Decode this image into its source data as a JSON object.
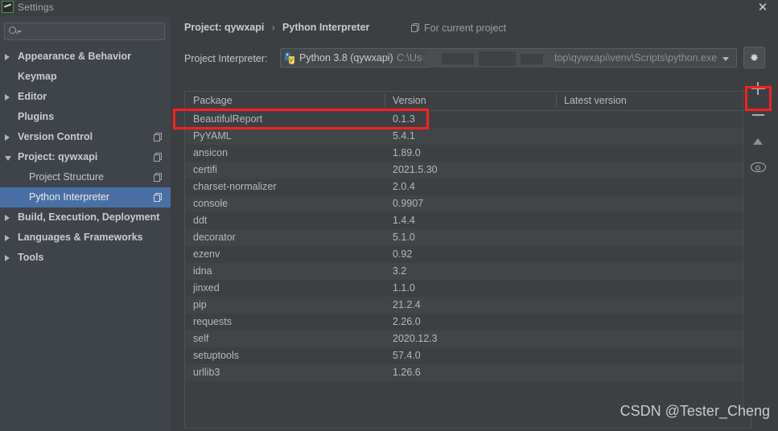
{
  "window": {
    "title": "Settings",
    "app_icon": "pycharm-icon",
    "close_label": "✕"
  },
  "sidebar": {
    "search": {
      "value": "",
      "placeholder": "",
      "icon": "search-icon"
    },
    "items": [
      {
        "label": "Appearance & Behavior",
        "indent": 22,
        "arrow": "closed",
        "bold": true,
        "copy": false,
        "selected": false
      },
      {
        "label": "Keymap",
        "indent": 22,
        "arrow": "none",
        "bold": true,
        "copy": false,
        "selected": false
      },
      {
        "label": "Editor",
        "indent": 22,
        "arrow": "closed",
        "bold": true,
        "copy": false,
        "selected": false
      },
      {
        "label": "Plugins",
        "indent": 22,
        "arrow": "none",
        "bold": true,
        "copy": false,
        "selected": false
      },
      {
        "label": "Version Control",
        "indent": 22,
        "arrow": "closed",
        "bold": true,
        "copy": true,
        "selected": false
      },
      {
        "label": "Project: qywxapi",
        "indent": 22,
        "arrow": "open",
        "bold": true,
        "copy": true,
        "selected": false
      },
      {
        "label": "Project Structure",
        "indent": 36,
        "arrow": "none",
        "bold": false,
        "copy": true,
        "selected": false
      },
      {
        "label": "Python Interpreter",
        "indent": 36,
        "arrow": "none",
        "bold": false,
        "copy": true,
        "selected": true
      },
      {
        "label": "Build, Execution, Deployment",
        "indent": 22,
        "arrow": "closed",
        "bold": true,
        "copy": false,
        "selected": false
      },
      {
        "label": "Languages & Frameworks",
        "indent": 22,
        "arrow": "closed",
        "bold": true,
        "copy": false,
        "selected": false
      },
      {
        "label": "Tools",
        "indent": 22,
        "arrow": "closed",
        "bold": true,
        "copy": false,
        "selected": false
      }
    ]
  },
  "header": {
    "breadcrumb": [
      "Project: qywxapi",
      "Python Interpreter"
    ],
    "breadcrumb_separator": "›",
    "for_current_project": "For current project",
    "for_current_project_icon": "copy-icon"
  },
  "interpreter": {
    "label": "Project Interpreter:",
    "icon": "python-venv-icon",
    "name": "Python 3.8 (qywxapi)",
    "path_prefix": "C:\\Use",
    "path_suffix": "top\\qywxapi\\venv\\Scripts\\python.exe",
    "redacted": true,
    "dropdown_icon": "chevron-down-icon",
    "settings_icon": "gear-icon"
  },
  "packages_table": {
    "columns": [
      "Package",
      "Version",
      "Latest version"
    ],
    "rows": [
      {
        "package": "BeautifulReport",
        "version": "0.1.3",
        "latest": ""
      },
      {
        "package": "PyYAML",
        "version": "5.4.1",
        "latest": ""
      },
      {
        "package": "ansicon",
        "version": "1.89.0",
        "latest": ""
      },
      {
        "package": "certifi",
        "version": "2021.5.30",
        "latest": ""
      },
      {
        "package": "charset-normalizer",
        "version": "2.0.4",
        "latest": ""
      },
      {
        "package": "console",
        "version": "0.9907",
        "latest": ""
      },
      {
        "package": "ddt",
        "version": "1.4.4",
        "latest": ""
      },
      {
        "package": "decorator",
        "version": "5.1.0",
        "latest": ""
      },
      {
        "package": "ezenv",
        "version": "0.92",
        "latest": ""
      },
      {
        "package": "idna",
        "version": "3.2",
        "latest": ""
      },
      {
        "package": "jinxed",
        "version": "1.1.0",
        "latest": ""
      },
      {
        "package": "pip",
        "version": "21.2.4",
        "latest": ""
      },
      {
        "package": "requests",
        "version": "2.26.0",
        "latest": ""
      },
      {
        "package": "self",
        "version": "2020.12.3",
        "latest": ""
      },
      {
        "package": "setuptools",
        "version": "57.4.0",
        "latest": ""
      },
      {
        "package": "urllib3",
        "version": "1.26.6",
        "latest": ""
      }
    ]
  },
  "toolbar": {
    "install_icon": "plus-icon",
    "uninstall_icon": "minus-icon",
    "upgrade_icon": "triangle-up-icon",
    "show_early_releases_icon": "eye-icon"
  },
  "annotations": {
    "accent_color": "#ff2020",
    "highlight_row": "BeautifulReport",
    "highlight_button": "install-package-button"
  },
  "watermark": {
    "text": "CSDN @Tester_Cheng"
  },
  "colors": {
    "window_bg": "#3c3f41",
    "sidebar_bg": "#3f434a",
    "selection_blue": "#4a6fa5",
    "row_odd": "#3c4043",
    "row_even": "#414548",
    "text": "#b6b9bb",
    "annotation_red": "#ff2020"
  }
}
